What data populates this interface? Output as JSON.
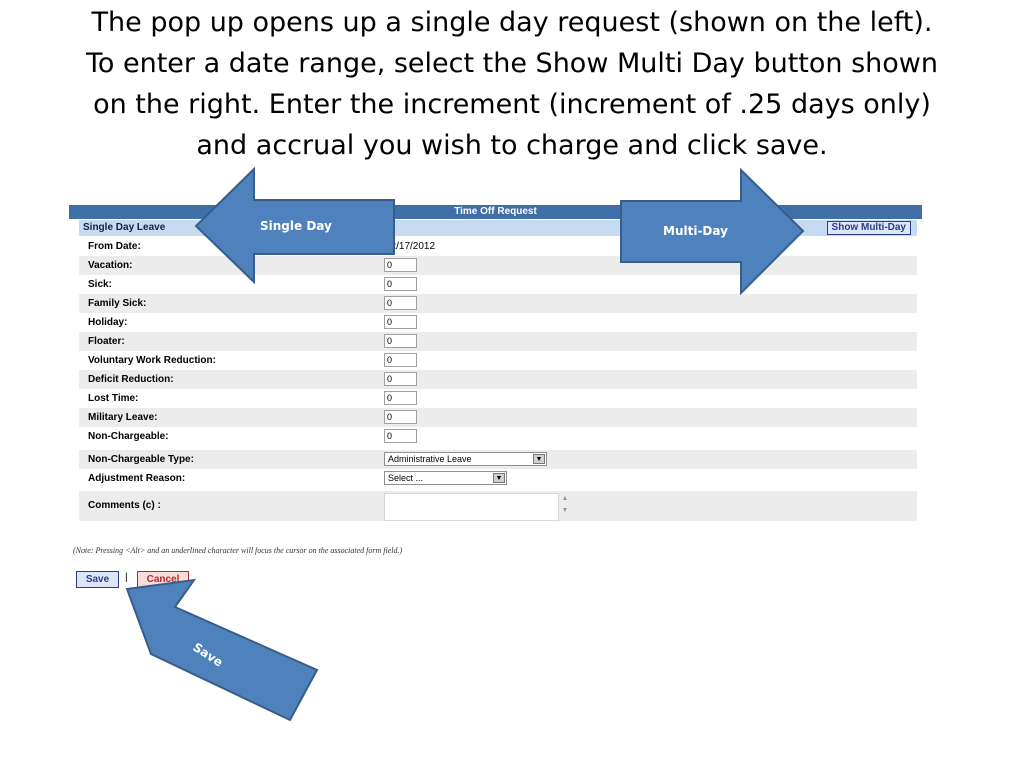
{
  "slide": {
    "title_lines": [
      "The pop up opens up a single day request (shown on the left).",
      "To enter a date range, select the Show Multi Day button shown",
      "on the right.  Enter the increment (increment of .25 days only)",
      "and accrual you wish to charge and click save."
    ]
  },
  "form": {
    "title": "Time Off Request",
    "header_label": "Single Day Leave",
    "show_multi_day_label": "Show Multi-Day",
    "from_date_label": "From Date:",
    "from_date_value": "12/17/2012",
    "rows": [
      {
        "label": "Vacation:",
        "value": "0"
      },
      {
        "label": "Sick:",
        "value": "0"
      },
      {
        "label": "Family Sick:",
        "value": "0"
      },
      {
        "label": "Holiday:",
        "value": "0"
      },
      {
        "label": "Floater:",
        "value": "0"
      },
      {
        "label": "Voluntary Work Reduction:",
        "value": "0"
      },
      {
        "label": "Deficit Reduction:",
        "value": "0"
      },
      {
        "label": "Lost Time:",
        "value": "0"
      },
      {
        "label": "Military Leave:",
        "value": "0"
      },
      {
        "label": "Non-Chargeable:",
        "value": "0"
      }
    ],
    "non_chargeable_type_label": "Non-Chargeable Type:",
    "non_chargeable_type_value": "Administrative Leave",
    "adjustment_reason_label": "Adjustment Reason:",
    "adjustment_reason_value": "Select ...",
    "comments_label": "Comments (c) :",
    "note": "(Note: Pressing <Alt> and an underlined character will focus the cursor on the associated form field.)",
    "save_label": "Save",
    "separator": "|",
    "cancel_label": "Cancel"
  },
  "callouts": {
    "single_day": "Single Day",
    "multi_day": "Multi-Day",
    "save": "Save"
  },
  "colors": {
    "arrow_fill": "#4f81bd",
    "arrow_stroke": "#385d8a",
    "title_bar": "#3f6ea9",
    "header_bar": "#c6dbf1",
    "row_alt": "#ececec",
    "link_blue": "#273e8c",
    "cancel_red": "#b52a2a"
  }
}
